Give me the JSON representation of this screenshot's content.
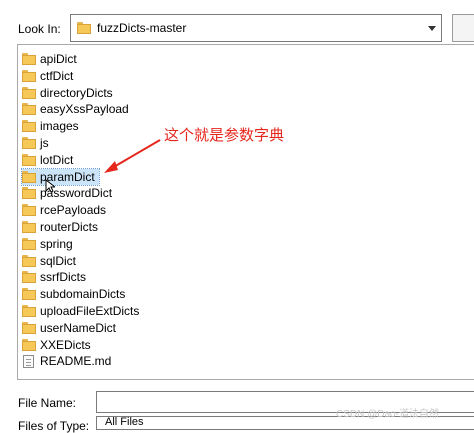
{
  "dialog": {
    "look_in_label": "Look In:",
    "look_in_value": "fuzzDicts-master",
    "file_name_label": "File Name:",
    "file_name_value": "",
    "file_type_label": "Files of Type:",
    "file_type_value": "All Files"
  },
  "files": [
    {
      "label": "apiDict",
      "icon": "folder-icon"
    },
    {
      "label": "ctfDict",
      "icon": "folder-icon"
    },
    {
      "label": "directoryDicts",
      "icon": "folder-icon"
    },
    {
      "label": "easyXssPayload",
      "icon": "folder-icon"
    },
    {
      "label": "images",
      "icon": "folder-icon"
    },
    {
      "label": "js",
      "icon": "folder-icon"
    },
    {
      "label": "lotDict",
      "icon": "folder-icon"
    },
    {
      "label": "paramDict",
      "icon": "folder-icon",
      "selected": true
    },
    {
      "label": "passwordDict",
      "icon": "folder-icon"
    },
    {
      "label": "rcePayloads",
      "icon": "folder-icon"
    },
    {
      "label": "routerDicts",
      "icon": "folder-icon"
    },
    {
      "label": "spring",
      "icon": "folder-icon"
    },
    {
      "label": "sqlDict",
      "icon": "folder-icon"
    },
    {
      "label": "ssrfDicts",
      "icon": "folder-icon"
    },
    {
      "label": "subdomainDicts",
      "icon": "folder-icon"
    },
    {
      "label": "uploadFileExtDicts",
      "icon": "folder-icon"
    },
    {
      "label": "userNameDict",
      "icon": "folder-icon"
    },
    {
      "label": "XXEDicts",
      "icon": "folder-icon"
    },
    {
      "label": "README.md",
      "icon": "file-icon"
    }
  ],
  "annotation": {
    "text": "这个就是参数字典",
    "color": "#e5271c"
  },
  "watermark": "CSDN @Dao-道法自然",
  "colors": {
    "selection": "#cce4f7",
    "folder": "#f5c857"
  }
}
